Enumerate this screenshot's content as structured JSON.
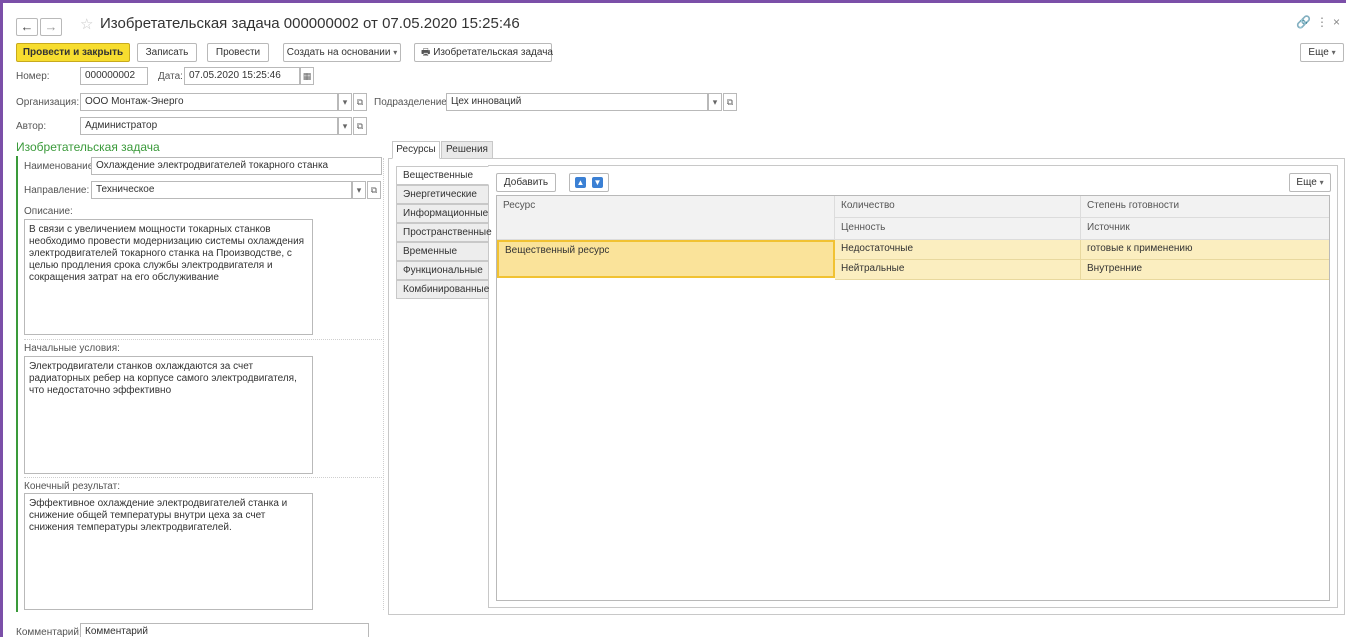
{
  "window": {
    "title": "Изобретательская задача 000000002 от 07.05.2020 15:25:46",
    "back_icon": "←",
    "forward_icon": "→",
    "star_icon": "☆",
    "link_icon": "🔗",
    "more_icon": "⋮",
    "close_icon": "×"
  },
  "toolbar": {
    "post_close": "Провести и закрыть",
    "save": "Записать",
    "post": "Провести",
    "create_based": "Создать на основании",
    "print": "Изобретательская задача",
    "more": "Еще"
  },
  "header": {
    "number_label": "Номер:",
    "number_value": "000000002",
    "date_label": "Дата:",
    "date_value": "07.05.2020 15:25:46",
    "org_label": "Организация:",
    "org_value": "ООО Монтаж-Энерго",
    "dept_label": "Подразделение:",
    "dept_value": "Цех инноваций",
    "author_label": "Автор:",
    "author_value": "Администратор"
  },
  "task": {
    "section_title": "Изобретательская задача",
    "name_label": "Наименование:",
    "name_value": "Охлаждение электродвигателей токарного станка",
    "direction_label": "Направление:",
    "direction_value": "Техническое",
    "description_label": "Описание:",
    "description_value": "В связи с увеличением мощности токарных станков необходимо провести модернизацию системы охлаждения электродвигателей токарного станка на Производстве, с целью продления срока службы электродвигателя и сокращения затрат на его обслуживание",
    "initial_label": "Начальные условия:",
    "initial_value": "Электродвигатели станков охлаждаются за счет радиаторных ребер на корпусе самого электродвигателя, что недостаточно эффективно",
    "result_label": "Конечный результат:",
    "result_value": "Эффективное охлаждение электродвигателей станка и снижение общей температуры внутри цеха за счет снижения температуры электродвигателей."
  },
  "comment": {
    "label": "Комментарий:",
    "value": "Комментарий"
  },
  "tabs": {
    "resources": "Ресурсы",
    "solutions": "Решения"
  },
  "resource_types": [
    "Вещественные",
    "Энергетические",
    "Информационные",
    "Пространственные",
    "Временные",
    "Функциональные",
    "Комбинированные"
  ],
  "grid": {
    "add": "Добавить",
    "more": "Еще",
    "col_resource": "Ресурс",
    "col_quantity": "Количество",
    "col_value": "Ценность",
    "col_readiness": "Степень готовности",
    "col_source": "Источник",
    "rows": [
      {
        "resource": "Вещественный ресурс",
        "quantity": "Недостаточные",
        "readiness": "готовые к применению",
        "value": "Нейтральные",
        "source": "Внутренние"
      }
    ]
  }
}
